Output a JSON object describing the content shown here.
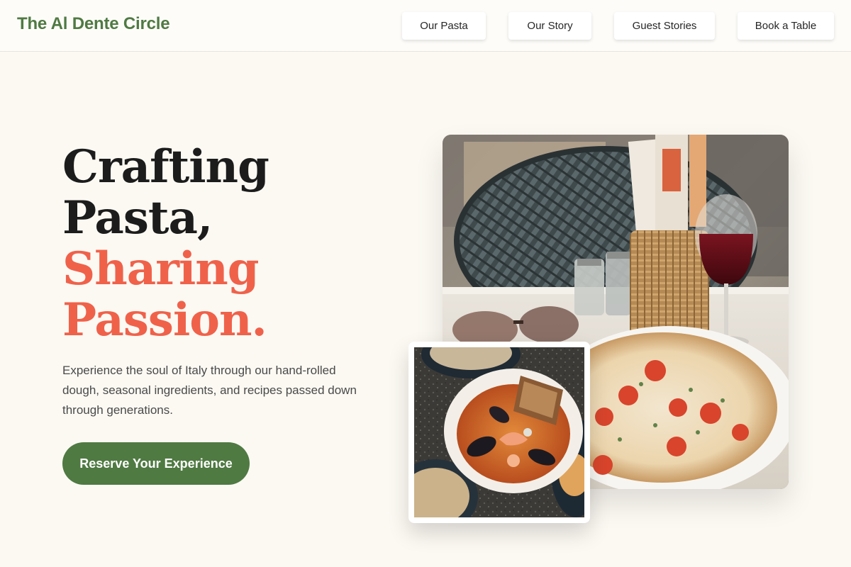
{
  "header": {
    "brand": "The Al Dente Circle",
    "nav": [
      "Our Pasta",
      "Our Story",
      "Guest Stories",
      "Book a Table"
    ]
  },
  "hero": {
    "headline_lines": [
      "Crafting",
      "Pasta,",
      "Sharing",
      "Passion."
    ],
    "description": "Experience the soul of Italy through our hand-rolled dough, seasonal ingredients, and recipes passed down through generations.",
    "cta_label": "Reserve Your Experience"
  },
  "images": {
    "main_photo": "restaurant-table-pizza-wine-photo",
    "secondary_photo": "seafood-pasta-bowl-photo"
  },
  "colors": {
    "brand_green": "#4f7a42",
    "accent_coral": "#f0614a",
    "background": "#fcf9f3"
  }
}
